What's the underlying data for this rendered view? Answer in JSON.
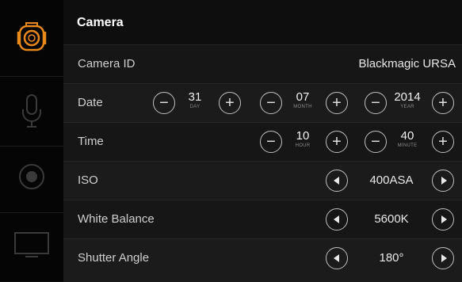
{
  "sidebar": {
    "items": [
      {
        "icon": "camera-icon",
        "active": true,
        "color": "#e8891c"
      },
      {
        "icon": "microphone-icon",
        "active": false
      },
      {
        "icon": "record-icon",
        "active": false
      },
      {
        "icon": "monitor-icon",
        "active": false
      }
    ]
  },
  "header": {
    "title": "Camera"
  },
  "settings": {
    "camera_id": {
      "label": "Camera ID",
      "value": "Blackmagic URSA"
    },
    "date": {
      "label": "Date",
      "day": {
        "value": "31",
        "unit": "DAY"
      },
      "month": {
        "value": "07",
        "unit": "MONTH"
      },
      "year": {
        "value": "2014",
        "unit": "YEAR"
      }
    },
    "time": {
      "label": "Time",
      "hour": {
        "value": "10",
        "unit": "HOUR"
      },
      "minute": {
        "value": "40",
        "unit": "MINUTE"
      }
    },
    "iso": {
      "label": "ISO",
      "value": "400ASA"
    },
    "white_balance": {
      "label": "White Balance",
      "value": "5600K"
    },
    "shutter_angle": {
      "label": "Shutter Angle",
      "value": "180°"
    }
  },
  "glyphs": {
    "minus": "−",
    "plus": "+"
  },
  "colors": {
    "accent": "#e8891c",
    "background": "#161616",
    "sidebar": "#050505"
  }
}
